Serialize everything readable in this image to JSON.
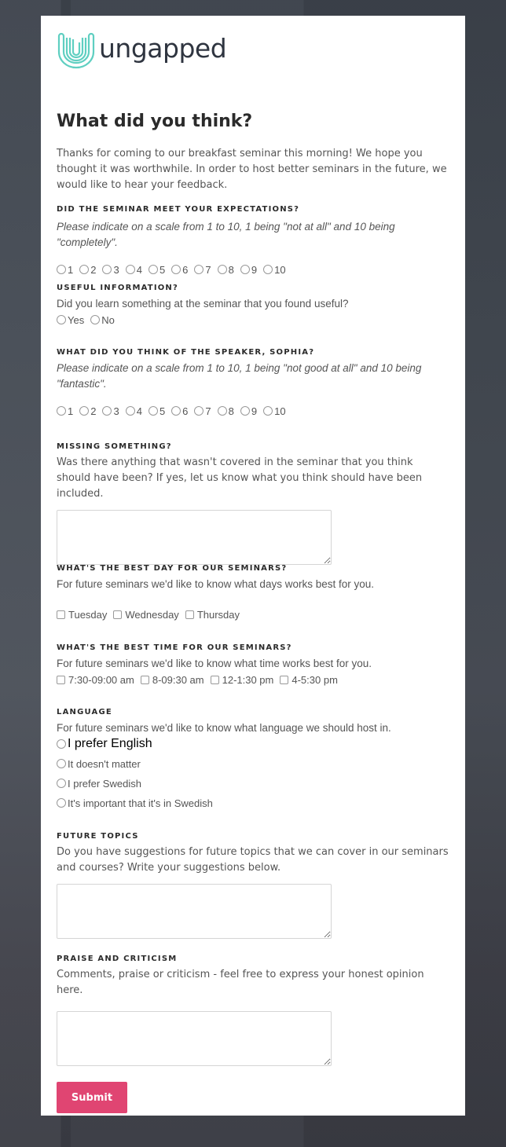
{
  "brand": {
    "name": "ungapped",
    "accent": "#5fcfc1",
    "button_color": "#e04572"
  },
  "page": {
    "title": "What did you think?",
    "intro": "Thanks for coming to our breakfast seminar this morning! We hope you thought it was worthwhile. In order to host better seminars in the future, we would like to hear your feedback."
  },
  "questions": {
    "expectations": {
      "label": "DID THE SEMINAR MEET YOUR EXPECTATIONS?",
      "desc": "Please indicate on a scale from 1 to 10, 1 being \"not at all\" and 10 being \"completely\".",
      "options": [
        "1",
        "2",
        "3",
        "4",
        "5",
        "6",
        "7",
        "8",
        "9",
        "10"
      ]
    },
    "useful": {
      "label": "USEFUL INFORMATION?",
      "desc": "Did you learn something at the seminar that you found useful?",
      "options": [
        "Yes",
        "No"
      ]
    },
    "speaker": {
      "label": "WHAT DID YOU THINK OF THE SPEAKER, SOPHIA?",
      "desc": "Please indicate on a scale from 1 to 10, 1 being \"not good at all\" and 10 being \"fantastic\".",
      "options": [
        "1",
        "2",
        "3",
        "4",
        "5",
        "6",
        "7",
        "8",
        "9",
        "10"
      ]
    },
    "missing": {
      "label": "MISSING SOMETHING?",
      "desc": "Was there anything that wasn't covered in the seminar that you think should have been? If yes, let us know what you think should have been included.",
      "value": ""
    },
    "best_day": {
      "label": "WHAT'S THE BEST DAY FOR OUR SEMINARS?",
      "desc": "For future seminars we'd like to know what days works best for you.",
      "options": [
        "Tuesday",
        "Wednesday",
        "Thursday"
      ]
    },
    "best_time": {
      "label": "WHAT'S THE BEST TIME FOR OUR SEMINARS?",
      "desc": "For future seminars we'd like to know what time works best for you.",
      "options": [
        "7:30-09:00 am",
        "8-09:30 am",
        "12-1:30 pm",
        "4-5:30 pm"
      ]
    },
    "language": {
      "label": "LANGUAGE",
      "desc": "For future seminars we'd like to know what language we should host in.",
      "options": [
        "I prefer English",
        "It doesn't matter",
        "I prefer Swedish",
        "It's important that it's in Swedish"
      ]
    },
    "future_topics": {
      "label": "FUTURE TOPICS",
      "desc": "Do you have suggestions for future topics that we can cover in our seminars and courses? Write your suggestions below.",
      "value": ""
    },
    "praise": {
      "label": "PRAISE AND CRITICISM",
      "desc": "Comments, praise or criticism - feel free to express your honest opinion here.",
      "value": ""
    }
  },
  "submit_label": "Submit"
}
